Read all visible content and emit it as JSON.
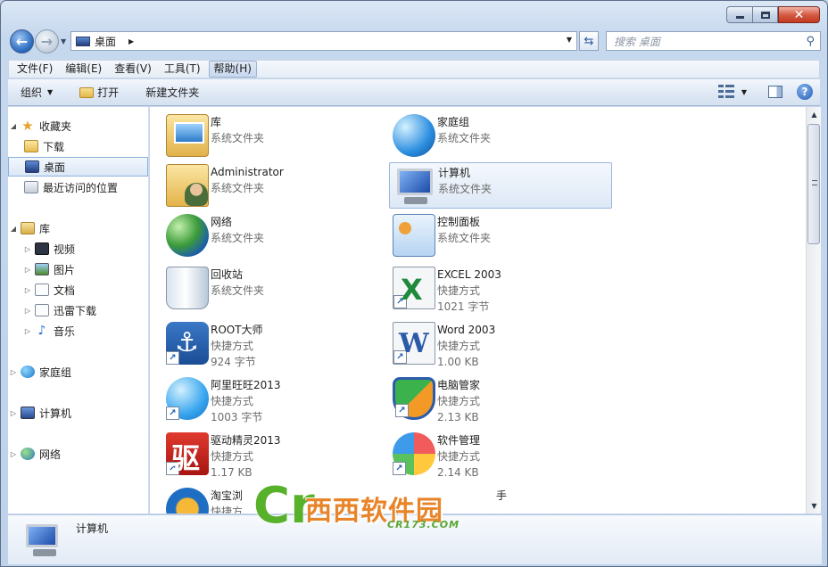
{
  "window": {
    "caption": {
      "minimize": "",
      "maximize": "",
      "close": "✕"
    }
  },
  "address_bar": {
    "breadcrumb": "桌面",
    "search_placeholder": "搜索 桌面"
  },
  "menubar": {
    "items": [
      "文件(F)",
      "编辑(E)",
      "查看(V)",
      "工具(T)",
      "帮助(H)"
    ],
    "active_index": 4
  },
  "command_bar": {
    "organize": "组织",
    "open": "打开",
    "new_folder": "新建文件夹"
  },
  "nav_pane": {
    "favorites": "收藏夹",
    "downloads": "下载",
    "desktop": "桌面",
    "recent": "最近访问的位置",
    "libraries": "库",
    "videos": "视频",
    "pictures": "图片",
    "documents": "文档",
    "thunder": "迅雷下载",
    "music": "音乐",
    "homegroup": "家庭组",
    "computer": "计算机",
    "network": "网络"
  },
  "items": [
    {
      "name": "库",
      "line2": "系统文件夹",
      "line3": ""
    },
    {
      "name": "家庭组",
      "line2": "系统文件夹",
      "line3": ""
    },
    {
      "name": "Administrator",
      "line2": "系统文件夹",
      "line3": ""
    },
    {
      "name": "计算机",
      "line2": "系统文件夹",
      "line3": ""
    },
    {
      "name": "网络",
      "line2": "系统文件夹",
      "line3": ""
    },
    {
      "name": "控制面板",
      "line2": "系统文件夹",
      "line3": ""
    },
    {
      "name": "回收站",
      "line2": "系统文件夹",
      "line3": ""
    },
    {
      "name": "EXCEL 2003",
      "line2": "快捷方式",
      "line3": "1021 字节"
    },
    {
      "name": "ROOT大师",
      "line2": "快捷方式",
      "line3": "924 字节"
    },
    {
      "name": "Word 2003",
      "line2": "快捷方式",
      "line3": "1.00 KB"
    },
    {
      "name": "阿里旺旺2013",
      "line2": "快捷方式",
      "line3": "1003 字节"
    },
    {
      "name": "电脑管家",
      "line2": "快捷方式",
      "line3": "2.13 KB"
    },
    {
      "name": "驱动精灵2013",
      "line2": "快捷方式",
      "line3": "1.17 KB"
    },
    {
      "name": "软件管理",
      "line2": "快捷方式",
      "line3": "2.14 KB"
    },
    {
      "name": "淘宝浏",
      "line2": "快捷方",
      "line3": ""
    },
    {
      "name": "手",
      "line2": "",
      "line3": ""
    }
  ],
  "details_pane": {
    "name": "计算机"
  },
  "watermark": {
    "logo_letter": "Cr",
    "brand": "西西软件园",
    "domain": "CR173.COM"
  },
  "icons": {
    "back": "back-arrow-icon",
    "forward": "forward-arrow-icon",
    "search": "search-icon",
    "help": "help-icon"
  }
}
